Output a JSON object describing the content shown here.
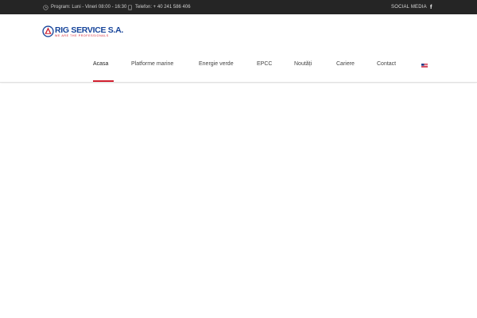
{
  "topbar": {
    "schedule_text": "Program:  Luni - Vineri 08:00 - 16:30",
    "schedule_icon": "clock-icon",
    "phone_text": "Telefon:  + 40 241 586 406",
    "phone_icon": "phone-icon",
    "social_label": "SOCIAL MEDIA",
    "facebook_glyph": "f",
    "facebook_icon": "facebook-icon",
    "background": "#252525"
  },
  "logo": {
    "name": "RIG SERVICE S.A.",
    "tagline": "WE ARE THE PROFESSIONALS",
    "brand_blue": "#16449a",
    "brand_red": "#d1202f"
  },
  "nav": {
    "items": [
      {
        "label": "Acasa",
        "active": true
      },
      {
        "label": "Platforme marine",
        "active": false
      },
      {
        "label": "Energie verde",
        "active": false
      },
      {
        "label": "EPCC",
        "active": false
      },
      {
        "label": "Noutăți",
        "active": false
      },
      {
        "label": "Cariere",
        "active": false
      },
      {
        "label": "Contact",
        "active": false
      }
    ],
    "language_icon": "us-flag-icon",
    "accent": "#d1202f"
  }
}
